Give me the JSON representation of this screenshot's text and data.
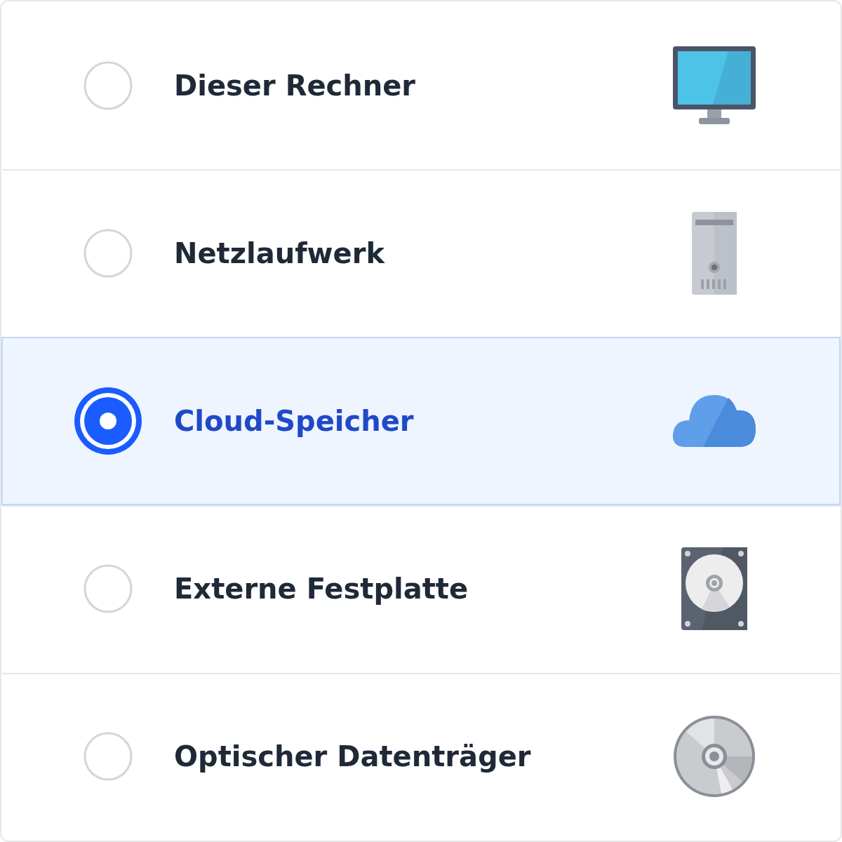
{
  "options": [
    {
      "label": "Dieser Rechner",
      "selected": false
    },
    {
      "label": "Netzlaufwerk",
      "selected": false
    },
    {
      "label": "Cloud-Speicher",
      "selected": true
    },
    {
      "label": "Externe Festplatte",
      "selected": false
    },
    {
      "label": "Optischer Datenträger",
      "selected": false
    }
  ]
}
